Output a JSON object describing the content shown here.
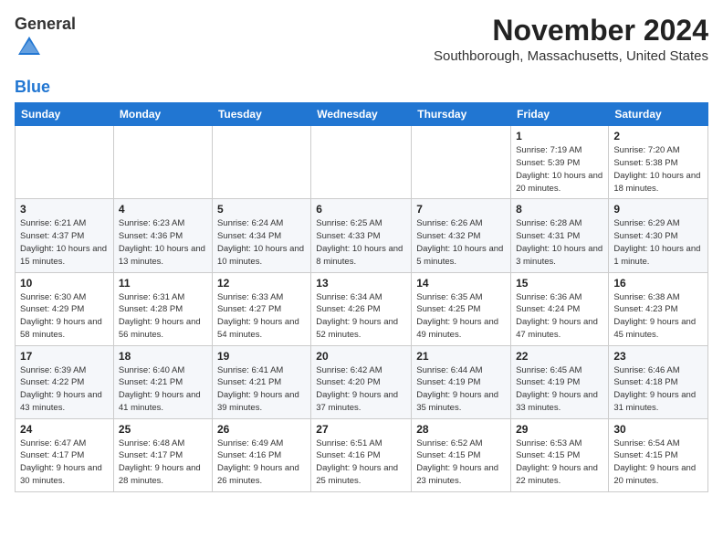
{
  "logo": {
    "general": "General",
    "blue": "Blue"
  },
  "header": {
    "month_title": "November 2024",
    "location": "Southborough, Massachusetts, United States"
  },
  "days_of_week": [
    "Sunday",
    "Monday",
    "Tuesday",
    "Wednesday",
    "Thursday",
    "Friday",
    "Saturday"
  ],
  "weeks": [
    [
      {
        "day": "",
        "info": ""
      },
      {
        "day": "",
        "info": ""
      },
      {
        "day": "",
        "info": ""
      },
      {
        "day": "",
        "info": ""
      },
      {
        "day": "",
        "info": ""
      },
      {
        "day": "1",
        "info": "Sunrise: 7:19 AM\nSunset: 5:39 PM\nDaylight: 10 hours and 20 minutes."
      },
      {
        "day": "2",
        "info": "Sunrise: 7:20 AM\nSunset: 5:38 PM\nDaylight: 10 hours and 18 minutes."
      }
    ],
    [
      {
        "day": "3",
        "info": "Sunrise: 6:21 AM\nSunset: 4:37 PM\nDaylight: 10 hours and 15 minutes."
      },
      {
        "day": "4",
        "info": "Sunrise: 6:23 AM\nSunset: 4:36 PM\nDaylight: 10 hours and 13 minutes."
      },
      {
        "day": "5",
        "info": "Sunrise: 6:24 AM\nSunset: 4:34 PM\nDaylight: 10 hours and 10 minutes."
      },
      {
        "day": "6",
        "info": "Sunrise: 6:25 AM\nSunset: 4:33 PM\nDaylight: 10 hours and 8 minutes."
      },
      {
        "day": "7",
        "info": "Sunrise: 6:26 AM\nSunset: 4:32 PM\nDaylight: 10 hours and 5 minutes."
      },
      {
        "day": "8",
        "info": "Sunrise: 6:28 AM\nSunset: 4:31 PM\nDaylight: 10 hours and 3 minutes."
      },
      {
        "day": "9",
        "info": "Sunrise: 6:29 AM\nSunset: 4:30 PM\nDaylight: 10 hours and 1 minute."
      }
    ],
    [
      {
        "day": "10",
        "info": "Sunrise: 6:30 AM\nSunset: 4:29 PM\nDaylight: 9 hours and 58 minutes."
      },
      {
        "day": "11",
        "info": "Sunrise: 6:31 AM\nSunset: 4:28 PM\nDaylight: 9 hours and 56 minutes."
      },
      {
        "day": "12",
        "info": "Sunrise: 6:33 AM\nSunset: 4:27 PM\nDaylight: 9 hours and 54 minutes."
      },
      {
        "day": "13",
        "info": "Sunrise: 6:34 AM\nSunset: 4:26 PM\nDaylight: 9 hours and 52 minutes."
      },
      {
        "day": "14",
        "info": "Sunrise: 6:35 AM\nSunset: 4:25 PM\nDaylight: 9 hours and 49 minutes."
      },
      {
        "day": "15",
        "info": "Sunrise: 6:36 AM\nSunset: 4:24 PM\nDaylight: 9 hours and 47 minutes."
      },
      {
        "day": "16",
        "info": "Sunrise: 6:38 AM\nSunset: 4:23 PM\nDaylight: 9 hours and 45 minutes."
      }
    ],
    [
      {
        "day": "17",
        "info": "Sunrise: 6:39 AM\nSunset: 4:22 PM\nDaylight: 9 hours and 43 minutes."
      },
      {
        "day": "18",
        "info": "Sunrise: 6:40 AM\nSunset: 4:21 PM\nDaylight: 9 hours and 41 minutes."
      },
      {
        "day": "19",
        "info": "Sunrise: 6:41 AM\nSunset: 4:21 PM\nDaylight: 9 hours and 39 minutes."
      },
      {
        "day": "20",
        "info": "Sunrise: 6:42 AM\nSunset: 4:20 PM\nDaylight: 9 hours and 37 minutes."
      },
      {
        "day": "21",
        "info": "Sunrise: 6:44 AM\nSunset: 4:19 PM\nDaylight: 9 hours and 35 minutes."
      },
      {
        "day": "22",
        "info": "Sunrise: 6:45 AM\nSunset: 4:19 PM\nDaylight: 9 hours and 33 minutes."
      },
      {
        "day": "23",
        "info": "Sunrise: 6:46 AM\nSunset: 4:18 PM\nDaylight: 9 hours and 31 minutes."
      }
    ],
    [
      {
        "day": "24",
        "info": "Sunrise: 6:47 AM\nSunset: 4:17 PM\nDaylight: 9 hours and 30 minutes."
      },
      {
        "day": "25",
        "info": "Sunrise: 6:48 AM\nSunset: 4:17 PM\nDaylight: 9 hours and 28 minutes."
      },
      {
        "day": "26",
        "info": "Sunrise: 6:49 AM\nSunset: 4:16 PM\nDaylight: 9 hours and 26 minutes."
      },
      {
        "day": "27",
        "info": "Sunrise: 6:51 AM\nSunset: 4:16 PM\nDaylight: 9 hours and 25 minutes."
      },
      {
        "day": "28",
        "info": "Sunrise: 6:52 AM\nSunset: 4:15 PM\nDaylight: 9 hours and 23 minutes."
      },
      {
        "day": "29",
        "info": "Sunrise: 6:53 AM\nSunset: 4:15 PM\nDaylight: 9 hours and 22 minutes."
      },
      {
        "day": "30",
        "info": "Sunrise: 6:54 AM\nSunset: 4:15 PM\nDaylight: 9 hours and 20 minutes."
      }
    ]
  ]
}
